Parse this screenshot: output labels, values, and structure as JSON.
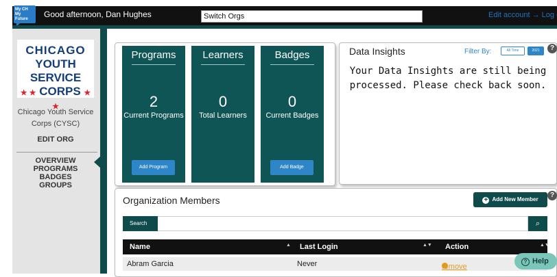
{
  "header": {
    "logo_text": "My CH My Future",
    "greeting": "Good afternoon, Dan Hughes",
    "switch_orgs": "Switch Orgs",
    "edit_account": "Edit account",
    "logout": "Log out"
  },
  "sidebar": {
    "org_logo": {
      "line1": "CHICAGO",
      "line2": "YOUTH SERVICE",
      "line3": "CORPS"
    },
    "org_name": "Chicago Youth Service Corps (CYSC)",
    "edit_org": "EDIT ORG",
    "nav": [
      "OVERVIEW",
      "PROGRAMS",
      "BADGES",
      "GROUPS"
    ]
  },
  "stats": {
    "programs": {
      "title": "Programs",
      "value": "2",
      "label": "Current Programs",
      "button": "Add Program"
    },
    "learners": {
      "title": "Learners",
      "value": "0",
      "label": "Total Learners"
    },
    "badges": {
      "title": "Badges",
      "value": "0",
      "label": "Current Badges",
      "button": "Add Badge"
    }
  },
  "insights": {
    "title": "Data Insights",
    "filter_label": "Filter By:",
    "filter_options": [
      "All Time",
      "2021"
    ],
    "message": "Your Data Insights are still being processed. Please check back soon."
  },
  "members": {
    "title": "Organization Members",
    "add_button": "Add New Member",
    "search_label": "Search",
    "columns": [
      "Name",
      "Last Login",
      "Action"
    ],
    "rows": [
      {
        "name": "Abram Garcia",
        "last_login": "Never",
        "action": "remove"
      }
    ]
  },
  "help_button": "Help",
  "colors": {
    "brand_teal": "#0f4b4b",
    "accent_blue": "#2e86c8",
    "action_orange": "#e39a1b"
  }
}
